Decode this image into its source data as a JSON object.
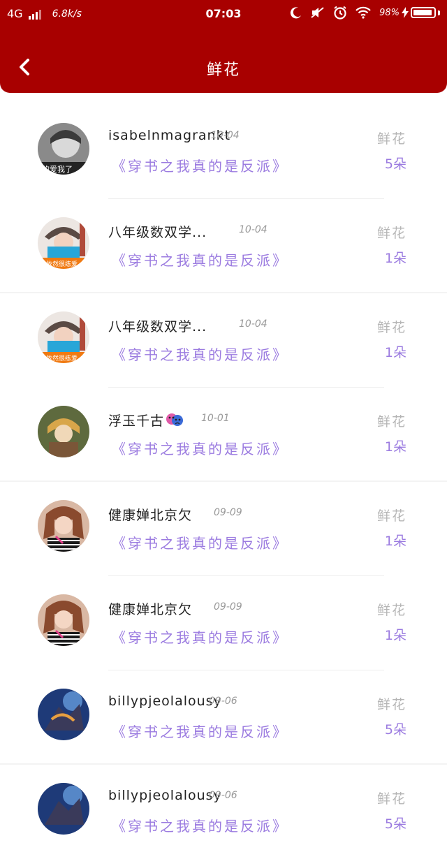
{
  "status_bar": {
    "network": "4G",
    "speed": "6.8k/s",
    "time": "07:03",
    "battery": "98%"
  },
  "header": {
    "title": "鲜花",
    "back_icon": "chevron-left-icon"
  },
  "colors": {
    "header_bg": "#a80000",
    "accent_purple": "#9b7be0",
    "muted_gray": "#b5b5b5"
  },
  "list": [
    {
      "name": "isabelnmagrankt",
      "date": "10-04",
      "book": "《穿书之我真的是反派》",
      "gift": "鲜花",
      "count": "5朵"
    },
    {
      "name": "八年级数双学...",
      "date": "10-04",
      "book": "《穿书之我真的是反派》",
      "gift": "鲜花",
      "count": "1朵"
    },
    {
      "name": "八年级数双学...",
      "date": "10-04",
      "book": "《穿书之我真的是反派》",
      "gift": "鲜花",
      "count": "1朵"
    },
    {
      "name": "浮玉千古",
      "date": "10-01",
      "book": "《穿书之我真的是反派》",
      "gift": "鲜花",
      "count": "1朵"
    },
    {
      "name": "健康婵北京欠",
      "date": "09-09",
      "book": "《穿书之我真的是反派》",
      "gift": "鲜花",
      "count": "1朵"
    },
    {
      "name": "健康婵北京欠",
      "date": "09-09",
      "book": "《穿书之我真的是反派》",
      "gift": "鲜花",
      "count": "1朵"
    },
    {
      "name": "billypjeolalousy",
      "date": "09-06",
      "book": "《穿书之我真的是反派》",
      "gift": "鲜花",
      "count": "5朵"
    },
    {
      "name": "billypjeolalousy",
      "date": "09-06",
      "book": "《穿书之我真的是反派》",
      "gift": "鲜花",
      "count": "5朵"
    }
  ]
}
